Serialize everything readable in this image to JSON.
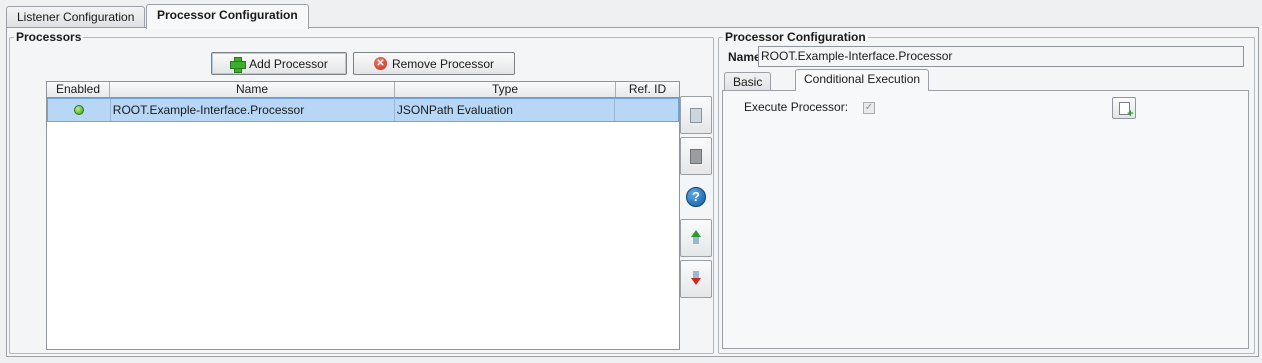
{
  "tabs": [
    {
      "label": "Listener Configuration",
      "active": false
    },
    {
      "label": "Processor Configuration",
      "active": true
    }
  ],
  "processors": {
    "title": "Processors",
    "add_label": "Add Processor",
    "remove_label": "Remove Processor",
    "columns": [
      "Enabled",
      "Name",
      "Type",
      "Ref. ID"
    ],
    "rows": [
      {
        "enabled": true,
        "name": "ROOT.Example-Interface.Processor",
        "type": "JSONPath Evaluation",
        "ref_id": ""
      }
    ],
    "side_buttons": [
      "copy-icon",
      "paste-icon",
      "help-icon",
      "move-up-icon",
      "move-down-icon"
    ]
  },
  "config": {
    "title": "Processor Configuration",
    "name_label": "Name:",
    "name_value": "ROOT.Example-Interface.Processor",
    "tabs": [
      {
        "label": "Basic",
        "active": false
      },
      {
        "label": "Conditional Execution",
        "active": true
      }
    ],
    "execute_label": "Execute Processor:",
    "execute_checked": true
  },
  "colors": {
    "selection": "#b8d6f5",
    "enabled_dot": "#3a9e19"
  }
}
